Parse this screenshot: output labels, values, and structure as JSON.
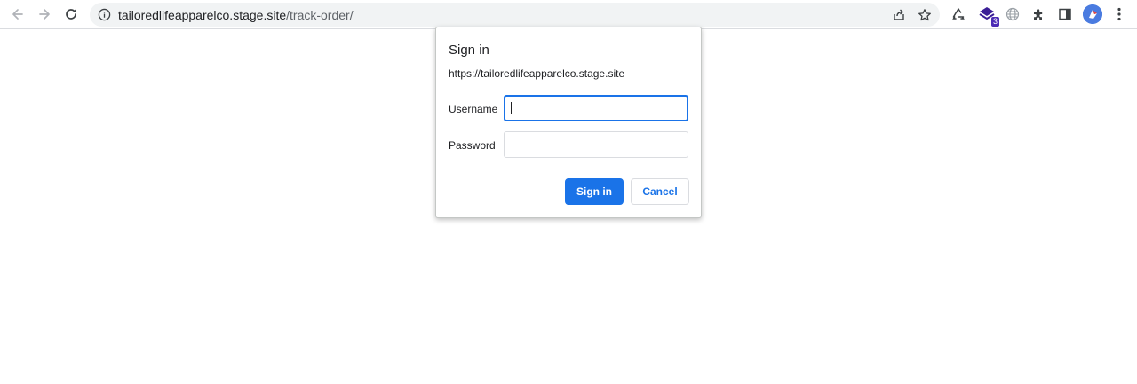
{
  "toolbar": {
    "url_host": "tailoredlifeapparelco.stage.site",
    "url_path": "/track-order/",
    "extension_badge": "3",
    "icons": {
      "back": "back-arrow-icon",
      "forward": "forward-arrow-icon",
      "reload": "reload-icon",
      "site_info": "info-icon",
      "share": "share-icon",
      "bookmark": "star-icon",
      "recycle": "recycle-icon",
      "extension_stack": "stack-extension-icon",
      "globe": "globe-icon",
      "extensions": "puzzle-icon",
      "side_panel": "side-panel-icon",
      "profile": "avatar",
      "menu": "kebab-menu-icon"
    }
  },
  "dialog": {
    "title": "Sign in",
    "origin": "https://tailoredlifeapparelco.stage.site",
    "username_label": "Username",
    "username_value": "",
    "password_label": "Password",
    "password_value": "",
    "sign_in_label": "Sign in",
    "cancel_label": "Cancel"
  },
  "colors": {
    "accent": "#1a73e8",
    "omnibox_bg": "#f1f3f4",
    "text": "#202124"
  }
}
